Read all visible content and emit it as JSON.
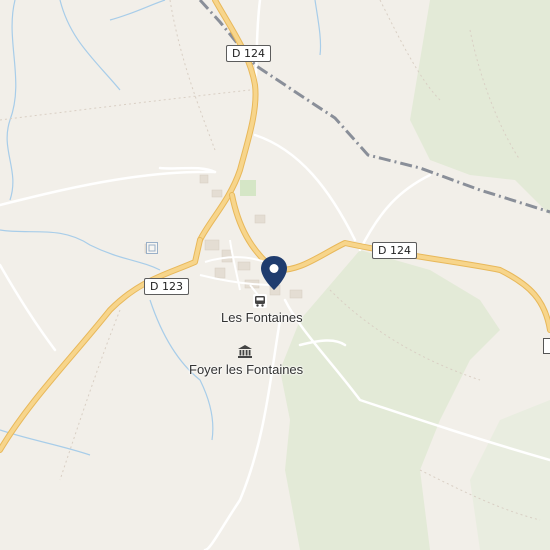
{
  "map": {
    "roads": {
      "d124_north": "D 124",
      "d124_east": "D 124",
      "d123": "D 123"
    },
    "places": {
      "village": "Les Fontaines",
      "foyer": "Foyer les Fontaines"
    },
    "icons": {
      "marker": "location-pin-icon",
      "bus": "bus-stop-icon",
      "museum": "museum-icon"
    },
    "colors": {
      "land": "#f2efe9",
      "forest": "#e3ead7",
      "water": "#a8cde9",
      "road_major": "#f7d58b",
      "road_casing": "#e8b85a",
      "railway": "#8a8f99",
      "marker": "#1f3c6e"
    }
  }
}
